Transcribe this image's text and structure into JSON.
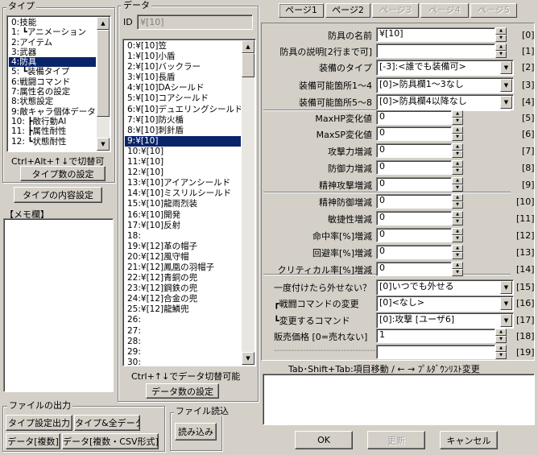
{
  "type_group": {
    "title": "タイプ",
    "items": [
      "0:技能",
      "1: ┗アニメーション",
      "2:アイテム",
      "3:武器",
      "4:防具",
      "5: ┗装備タイプ",
      "6:戦闘コマンド",
      "7:属性名の設定",
      "8:状態設定",
      "9:敵キャラ個体データ",
      "10: ┣敵行動AI",
      "11: ┣属性耐性",
      "12: ┗状態耐性"
    ],
    "selected_index": 4,
    "hint": "Ctrl+Alt+↑↓で切替可",
    "count_button": "タイプ数の設定",
    "content_button": "タイプの内容設定"
  },
  "memo": {
    "label": "【メモ欄】",
    "text": ""
  },
  "data_group": {
    "title": "データ",
    "id_label": "ID",
    "id_value": "¥[10]",
    "items": [
      "0:¥[10]笠",
      "1:¥[10]小盾",
      "2:¥[10]バックラー",
      "3:¥[10]長盾",
      "4:¥[10]DAシールド",
      "5:¥[10]コアシールド",
      "6:¥[10]デュエリングシールド",
      "7:¥[10]防火楯",
      "8:¥[10]刺針盾",
      "9:¥[10]",
      "10:¥[10]",
      "11:¥[10]",
      "12:¥[10]",
      "13:¥[10]アイアンシールド",
      "14:¥[10]ミスリルシールド",
      "15:¥[10]龍雨烈装",
      "16:¥[10]開発",
      "17:¥[10]反射",
      "18:",
      "19:¥[12]革の帽子",
      "20:¥[12]風守帽",
      "21:¥[12]鳳凰の羽帽子",
      "22:¥[12]青銅の兜",
      "23:¥[12]鋼鉄の兜",
      "24:¥[12]合金の兜",
      "25:¥[12]龍鱗兜",
      "26:",
      "27:",
      "28:",
      "29:",
      "30:"
    ],
    "selected_index": 9,
    "hint": "Ctrl+↑↓でデータ切替可能",
    "count_button": "データ数の設定"
  },
  "file_output": {
    "title": "ファイルの出力",
    "buttons": [
      "タイプ設定出力",
      "タイプ&全データ",
      "データ[複数]",
      "データ[複数・CSV形式]"
    ]
  },
  "file_read": {
    "title": "ファイル読込",
    "button": "読み込み"
  },
  "tabs": [
    "ページ1",
    "ページ2",
    "ページ3",
    "ページ4",
    "ページ5"
  ],
  "active_tab": 0,
  "fields": [
    {
      "label": "防具の名前",
      "value": "¥[10]",
      "idx": "[0]"
    },
    {
      "label": "防具の説明[2行まで可]",
      "value": "",
      "idx": "[1]"
    },
    {
      "label": "装備のタイプ",
      "value": "[-3]:<誰でも装備可>",
      "idx": "[2]"
    },
    {
      "label": "装備可能箇所1～4",
      "value": "[0]>防具欄1～3なし",
      "idx": "[3]"
    },
    {
      "label": "装備可能箇所5～8",
      "value": "[0]>防具欄4以降なし",
      "idx": "[4]"
    },
    {
      "label": "MaxHP変化値",
      "value": "0",
      "idx": "[5]"
    },
    {
      "label": "MaxSP変化値",
      "value": "0",
      "idx": "[6]"
    },
    {
      "label": "攻撃力増減",
      "value": "0",
      "idx": "[7]"
    },
    {
      "label": "防御力増減",
      "value": "0",
      "idx": "[8]"
    },
    {
      "label": "精神攻撃増減",
      "value": "0",
      "idx": "[9]"
    },
    {
      "label": "精神防御増減",
      "value": "0",
      "idx": "[10]"
    },
    {
      "label": "敏捷性増減",
      "value": "0",
      "idx": "[11]"
    },
    {
      "label": "命中率[%]増減",
      "value": "0",
      "idx": "[12]"
    },
    {
      "label": "回避率[%]増減",
      "value": "0",
      "idx": "[13]"
    },
    {
      "label": "クリティカル率[%]増減",
      "value": "0",
      "idx": "[14]"
    },
    {
      "label": "一度付けたら外せない？",
      "value": "[0]いつでも外せる",
      "idx": "[15]"
    },
    {
      "label": "┏戦闘コマンドの変更",
      "value": "[0]<なし>",
      "idx": "[16]"
    },
    {
      "label": "┗変更するコマンド",
      "value": "[0]:攻撃 [ユーザ6]",
      "idx": "[17]"
    },
    {
      "label": "販売価格 [0=売れない]",
      "value": "1",
      "idx": "[18]"
    },
    {
      "label": "-----------------------------------",
      "value": "",
      "idx": "[19]"
    }
  ],
  "hint_bar": "Tab･Shift+Tab:項目移動 / ← → ﾌﾟﾙﾀﾞｳﾝﾘｽﾄ変更",
  "bottom_buttons": {
    "ok": "OK",
    "update": "更新",
    "cancel": "キャンセル"
  }
}
